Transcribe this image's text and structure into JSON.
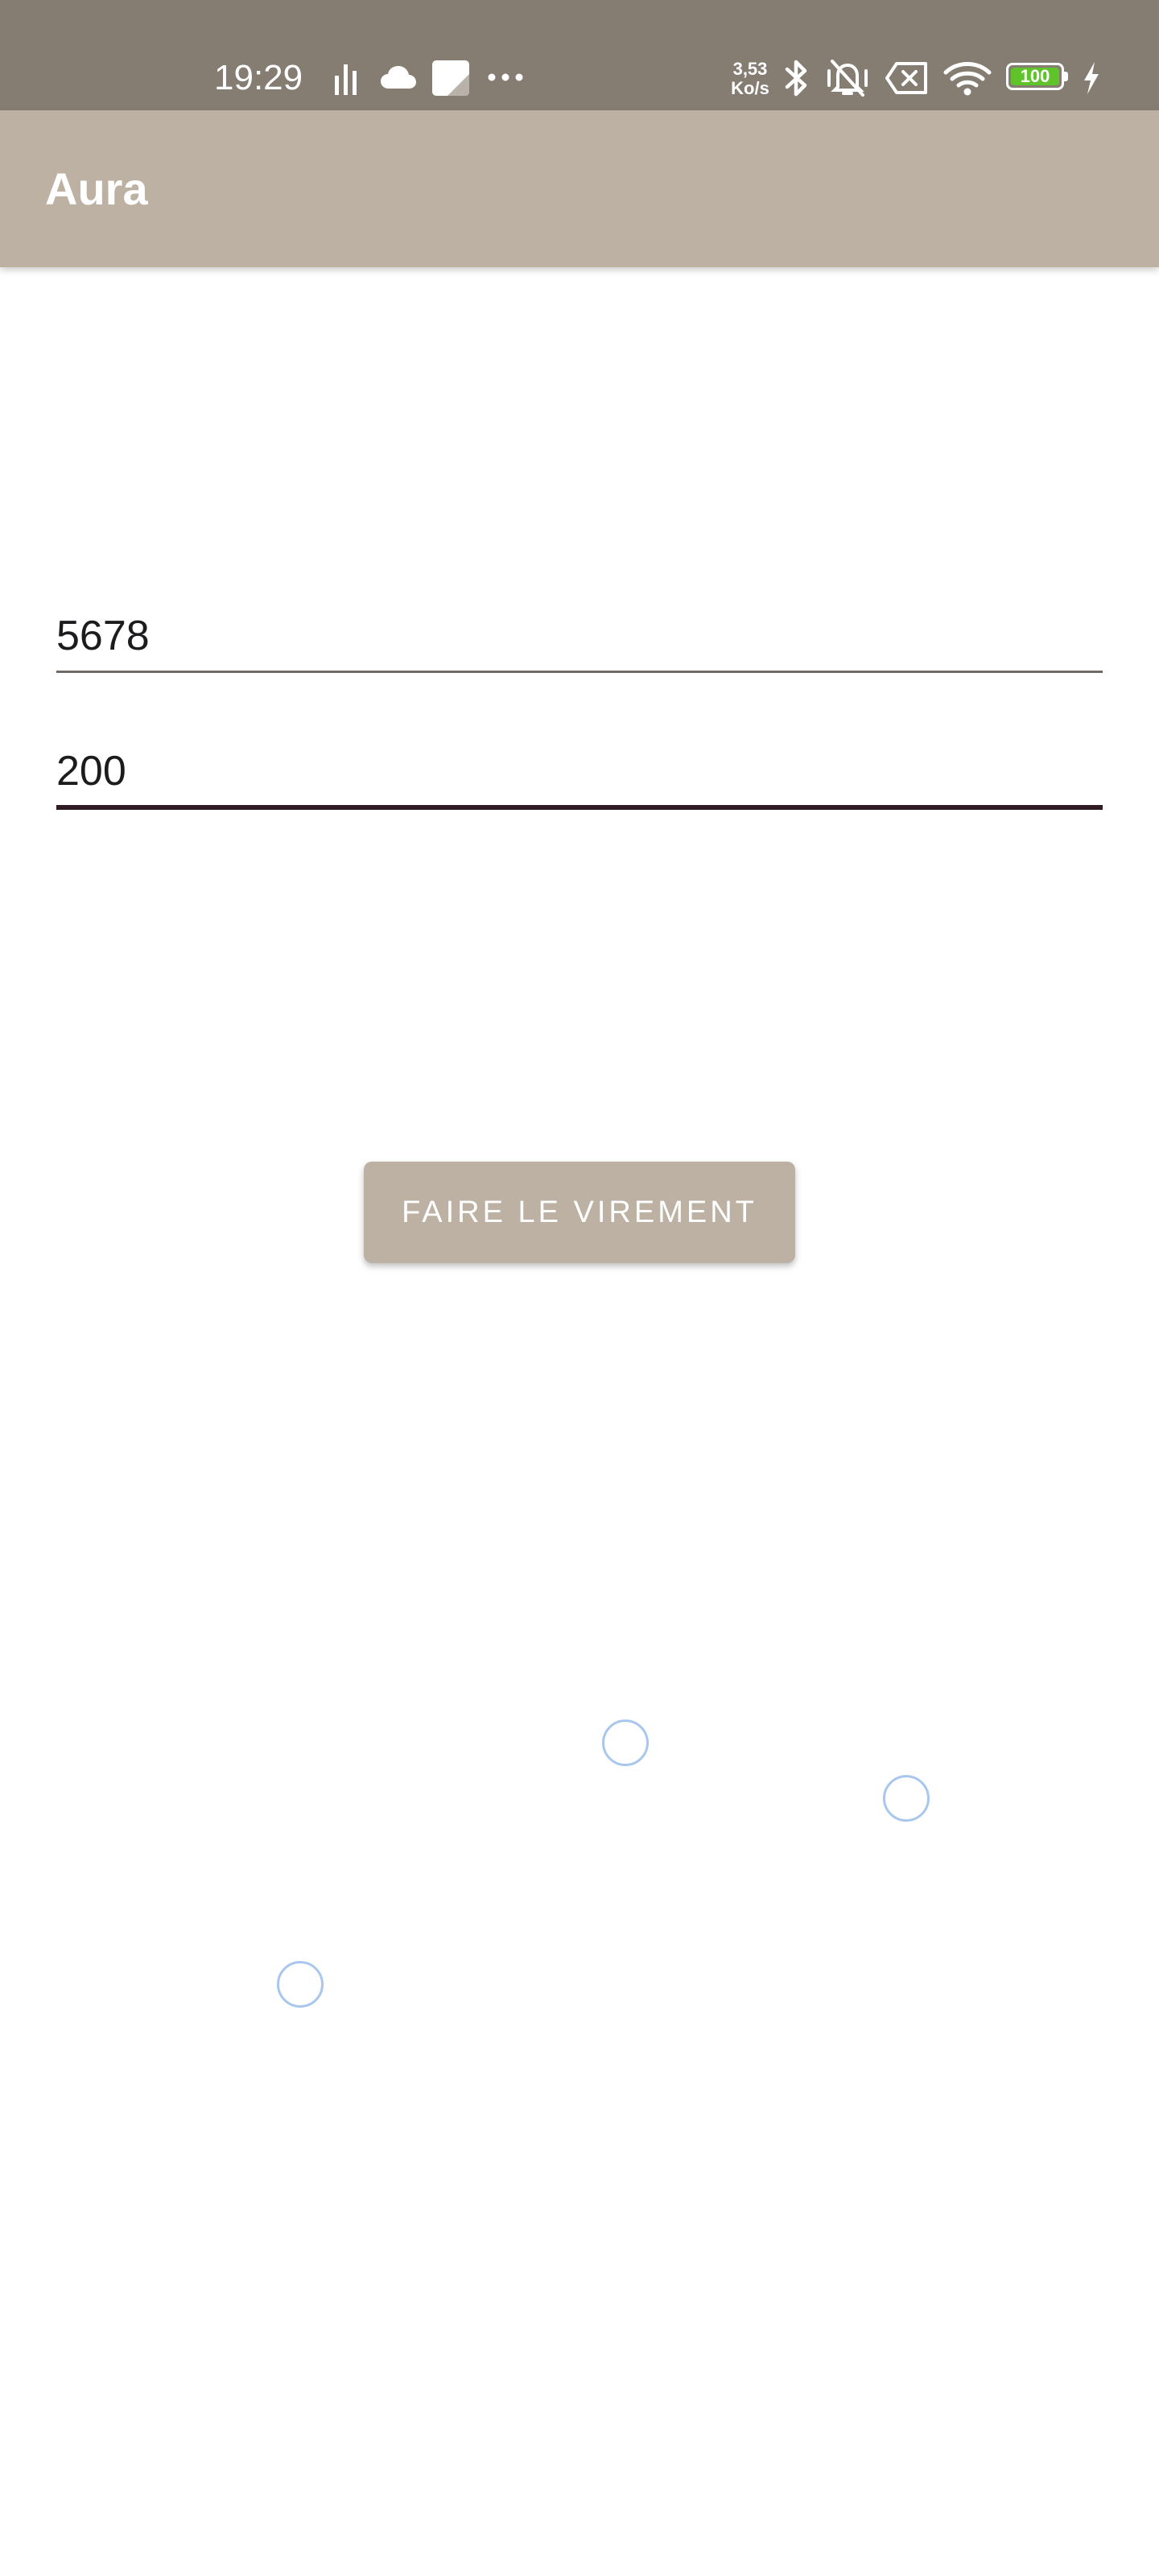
{
  "status_bar": {
    "time": "19:29",
    "net_speed_value": "3,53",
    "net_speed_unit": "Ko/s",
    "battery_level": "100",
    "icons": [
      "signal-bars-icon",
      "cloud-icon",
      "notes-icon",
      "more-dots-icon",
      "bluetooth-icon",
      "vibrate-off-icon",
      "sim-error-icon",
      "wifi-icon",
      "battery-icon",
      "charging-bolt-icon"
    ]
  },
  "app_bar": {
    "title": "Aura"
  },
  "form": {
    "account_value": "5678",
    "amount_value": "200",
    "submit_label": "FAIRE LE VIREMENT"
  },
  "colors": {
    "status_bar_bg": "#857d72",
    "app_bar_bg": "#bdb1a3",
    "button_bg": "#bdb1a3",
    "focused_underline": "#2f1b24",
    "battery_fill": "#5fc42a",
    "touch_indicator": "#a9c7ee"
  }
}
